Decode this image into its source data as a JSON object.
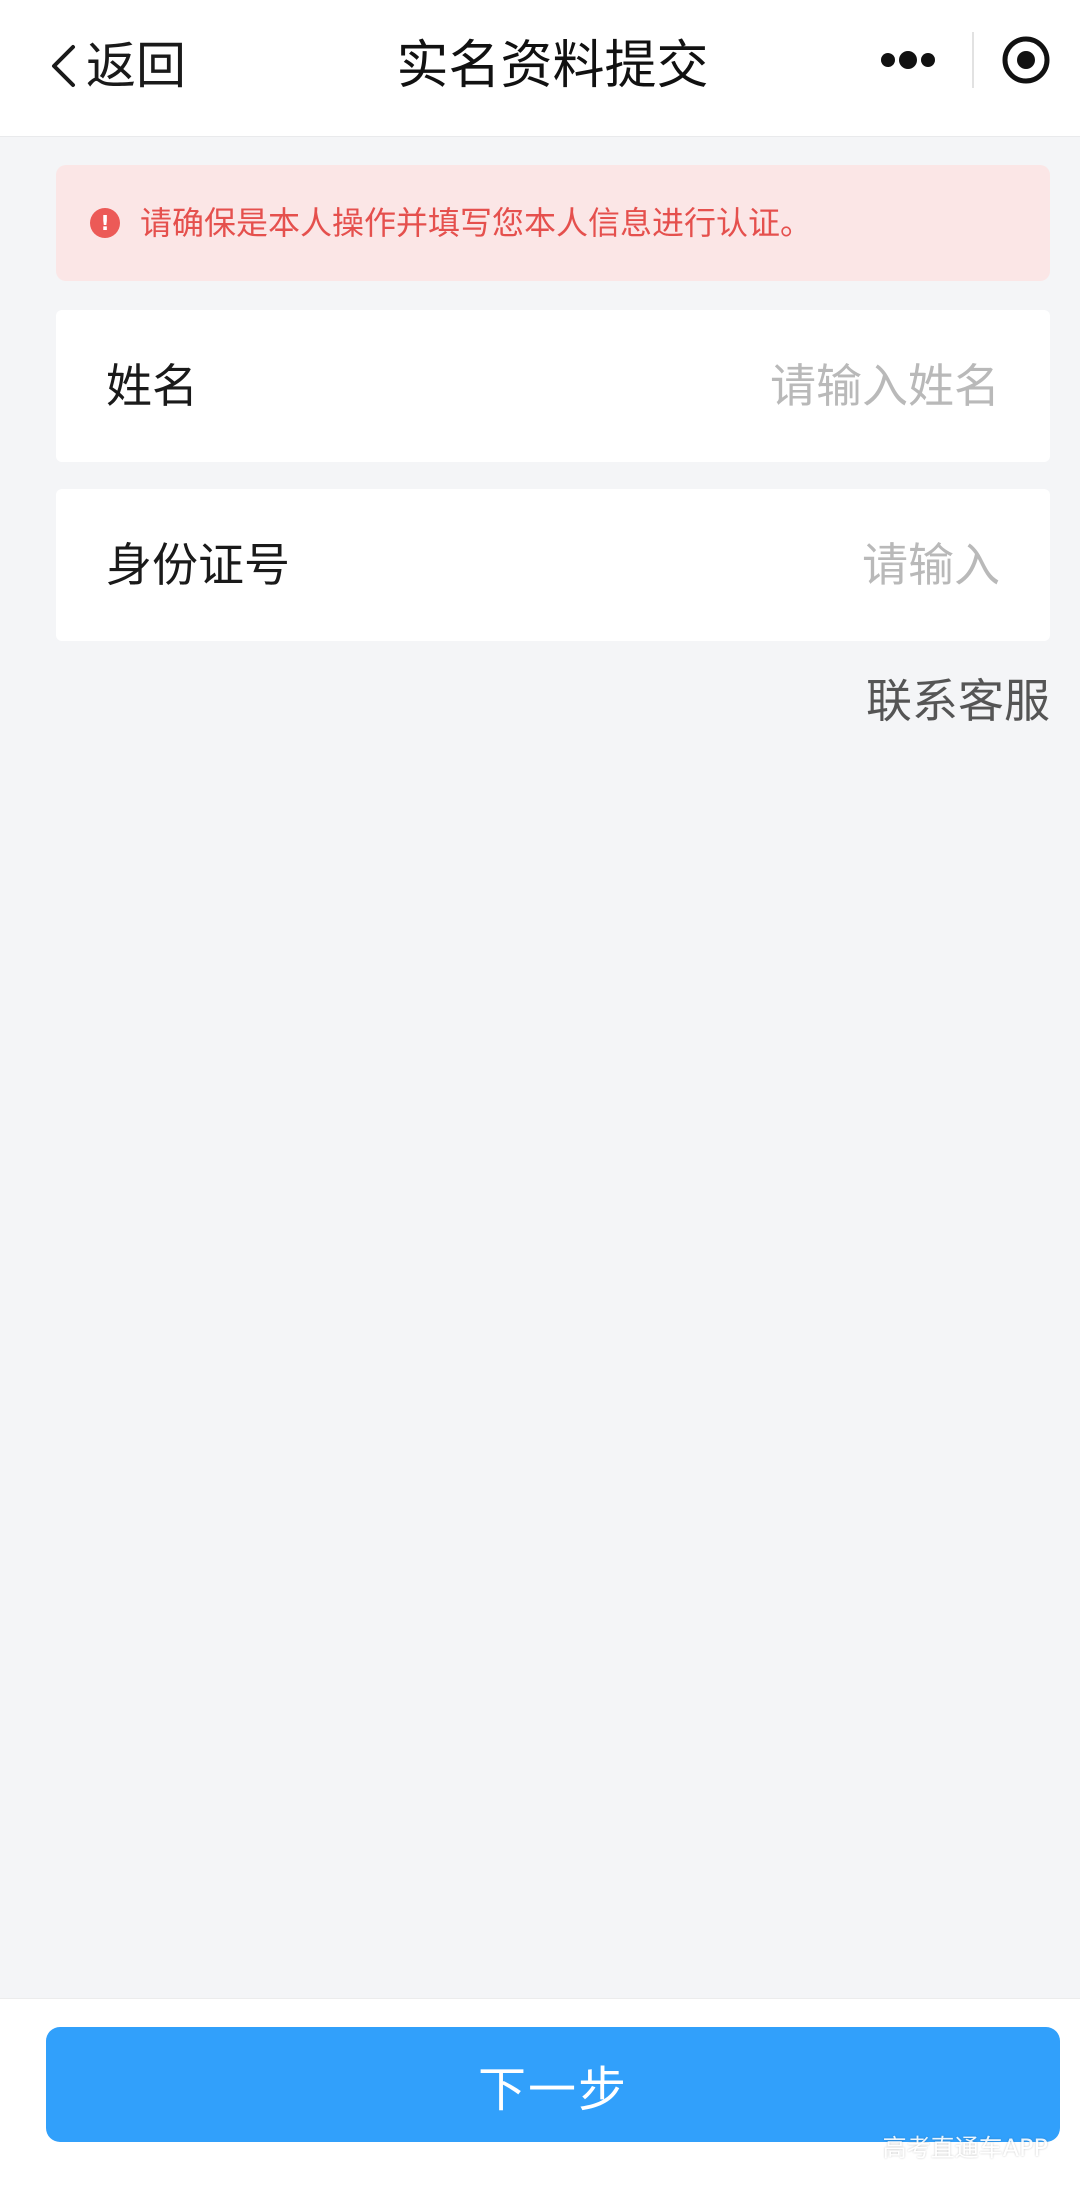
{
  "header": {
    "back_label": "返回",
    "title": "实名资料提交",
    "more_icon": "more-dots-icon",
    "close_icon": "target-close-icon"
  },
  "warning": {
    "icon": "alert-circle-icon",
    "icon_glyph": "!",
    "text": "请确保是本人操作并填写您本人信息进行认证。",
    "color": "#e5504d",
    "background": "#fbe6e6"
  },
  "form": {
    "name": {
      "label": "姓名",
      "value": "",
      "placeholder": "请输入姓名"
    },
    "id_number": {
      "label": "身份证号",
      "value": "",
      "placeholder": "请输入"
    }
  },
  "support_link": "联系客服",
  "next_button": {
    "label": "下一步",
    "color": "#31a0fb"
  },
  "watermark": "高考直通车APP"
}
